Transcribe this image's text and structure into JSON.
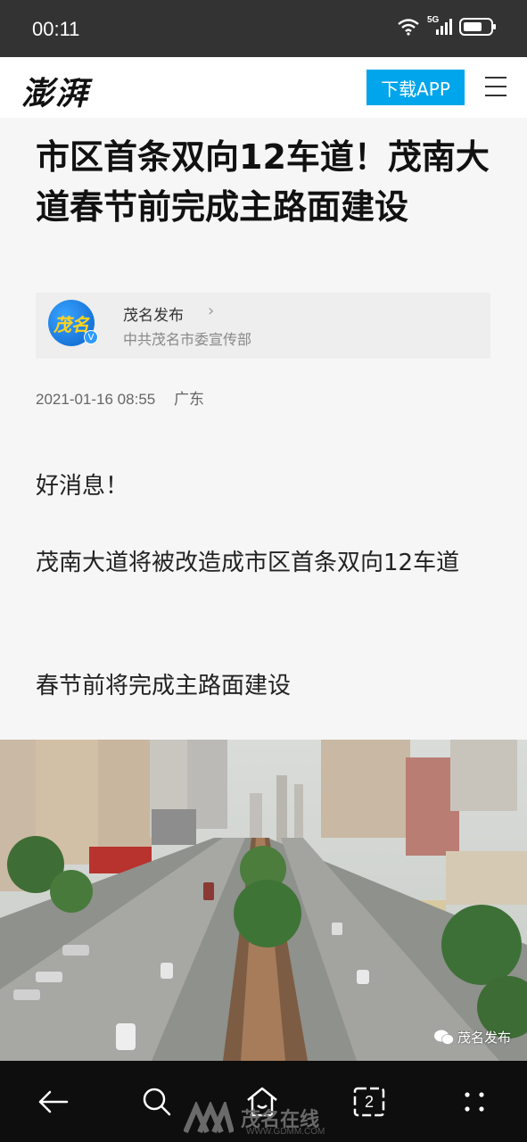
{
  "status_bar": {
    "time": "00:11",
    "network": "5G"
  },
  "header": {
    "logo": "澎湃",
    "download_label": "下载APP"
  },
  "article": {
    "title": "市区首条双向12车道！茂南大道春节前完成主路面建设",
    "author": {
      "name": "茂名发布",
      "description": "中共茂名市委宣传部",
      "avatar_text": "茂名"
    },
    "date": "2021-01-16 08:55",
    "location": "广东",
    "paragraphs": [
      "好消息！",
      "茂南大道将被改造成市区首条双向12车道",
      "春节前将完成主路面建设"
    ],
    "photo_watermark": "茂名发布"
  },
  "bottom_nav": {
    "tab_count": "2",
    "site_name": "茂名在线",
    "site_url": "WWW.GDMM.COM"
  }
}
